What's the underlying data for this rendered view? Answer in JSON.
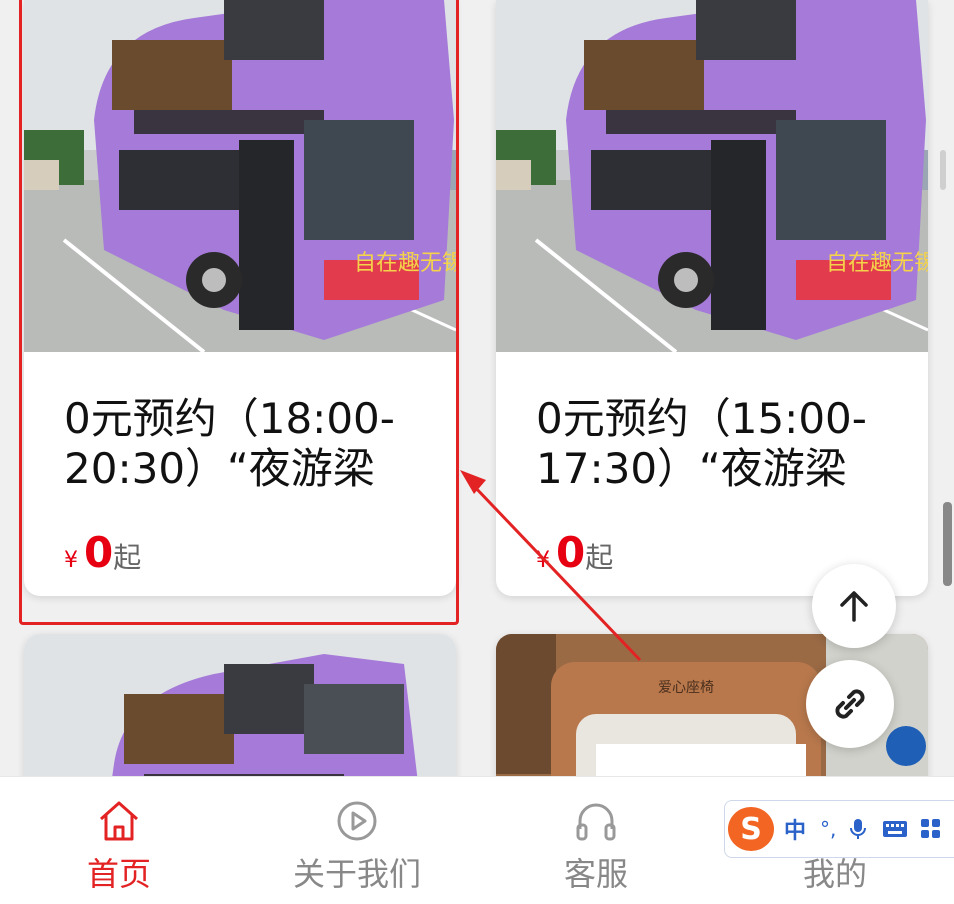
{
  "cards": [
    {
      "title": "0元预约（18:00-20:30）“夜游梁",
      "yen": "¥",
      "price": "0",
      "suffix": "起",
      "image": "double-decker-bus"
    },
    {
      "title": "0元预约（15:00-17:30）“夜游梁",
      "yen": "¥",
      "price": "0",
      "suffix": "起",
      "image": "double-decker-bus"
    },
    {
      "image": "double-decker-bus"
    },
    {
      "image": "bus-seat-interior",
      "seat_sign": "爱心座椅"
    }
  ],
  "bus_wrap_text": "自在趣无锡",
  "tabs": [
    {
      "label": "首页",
      "icon": "home-icon",
      "active": true
    },
    {
      "label": "关于我们",
      "icon": "play-icon",
      "active": false
    },
    {
      "label": "客服",
      "icon": "headphones-icon",
      "active": false
    },
    {
      "label": "我的",
      "icon": "user-icon",
      "active": false
    }
  ],
  "fab": {
    "top_icon": "arrow-up-icon",
    "link_icon": "link-icon"
  },
  "ime": {
    "logo": "S",
    "mode": "中",
    "punct": "°,"
  },
  "colors": {
    "accent": "#e32323",
    "price": "#e60012",
    "bus_purple": "#a57ad8"
  }
}
